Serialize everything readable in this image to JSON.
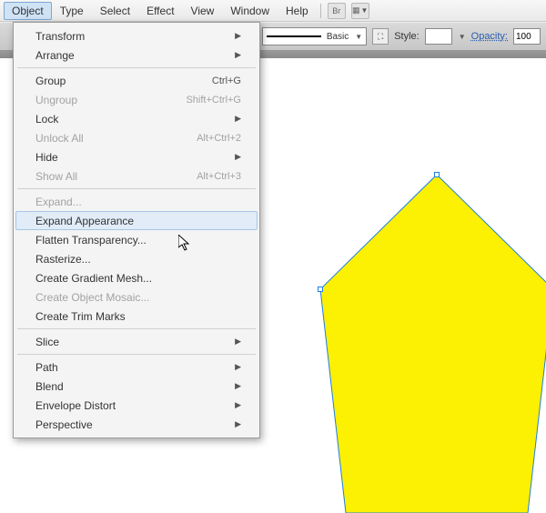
{
  "menubar": {
    "items": [
      {
        "label": "Object",
        "active": true
      },
      {
        "label": "Type"
      },
      {
        "label": "Select"
      },
      {
        "label": "Effect"
      },
      {
        "label": "View"
      },
      {
        "label": "Window"
      },
      {
        "label": "Help"
      }
    ]
  },
  "toolbar": {
    "stroke_style": "Basic",
    "style_label": "Style:",
    "opacity_label": "Opacity:",
    "opacity_value": "100"
  },
  "dropdown": {
    "groups": [
      [
        {
          "label": "Transform",
          "submenu": true
        },
        {
          "label": "Arrange",
          "submenu": true
        }
      ],
      [
        {
          "label": "Group",
          "shortcut": "Ctrl+G"
        },
        {
          "label": "Ungroup",
          "shortcut": "Shift+Ctrl+G",
          "disabled": true
        },
        {
          "label": "Lock",
          "submenu": true
        },
        {
          "label": "Unlock All",
          "shortcut": "Alt+Ctrl+2",
          "disabled": true
        },
        {
          "label": "Hide",
          "submenu": true
        },
        {
          "label": "Show All",
          "shortcut": "Alt+Ctrl+3",
          "disabled": true
        }
      ],
      [
        {
          "label": "Expand...",
          "disabled": true
        },
        {
          "label": "Expand Appearance",
          "hover": true
        },
        {
          "label": "Flatten Transparency..."
        },
        {
          "label": "Rasterize..."
        },
        {
          "label": "Create Gradient Mesh..."
        },
        {
          "label": "Create Object Mosaic...",
          "disabled": true
        },
        {
          "label": "Create Trim Marks"
        }
      ],
      [
        {
          "label": "Slice",
          "submenu": true
        }
      ],
      [
        {
          "label": "Path",
          "submenu": true
        },
        {
          "label": "Blend",
          "submenu": true
        },
        {
          "label": "Envelope Distort",
          "submenu": true
        },
        {
          "label": "Perspective",
          "submenu": true
        }
      ]
    ]
  },
  "canvas": {
    "shape_fill": "#fcf003",
    "shape_stroke": "#1e7fe0"
  }
}
